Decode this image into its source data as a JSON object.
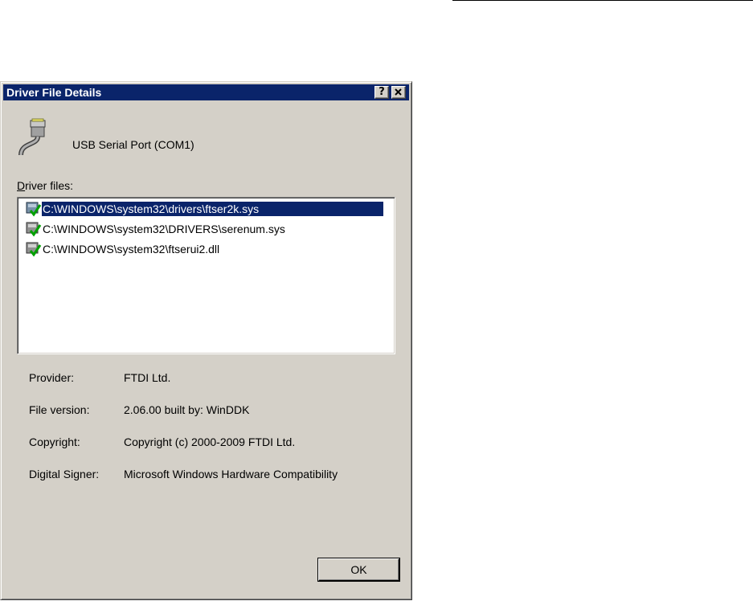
{
  "window": {
    "title": "Driver File Details",
    "help_label": "?",
    "close_label": "✕"
  },
  "device": {
    "name": "USB Serial Port (COM1)",
    "icon": "serial-port-icon"
  },
  "files": {
    "label_accel": "D",
    "label_rest": "river files:",
    "items": [
      {
        "path": "C:\\WINDOWS\\system32\\drivers\\ftser2k.sys",
        "selected": true,
        "icon": "signed-driver-icon"
      },
      {
        "path": "C:\\WINDOWS\\system32\\DRIVERS\\serenum.sys",
        "selected": false,
        "icon": "signed-driver-icon"
      },
      {
        "path": "C:\\WINDOWS\\system32\\ftserui2.dll",
        "selected": false,
        "icon": "signed-driver-icon"
      }
    ]
  },
  "details": {
    "provider_label": "Provider:",
    "provider_value": "FTDI Ltd.",
    "version_label": "File version:",
    "version_value": "2.06.00 built by: WinDDK",
    "copyright_label": "Copyright:",
    "copyright_value": "Copyright (c) 2000-2009 FTDI Ltd.",
    "signer_label": "Digital Signer:",
    "signer_value": "Microsoft Windows Hardware Compatibility"
  },
  "buttons": {
    "ok_label": "OK"
  },
  "colors": {
    "titlebar": "#0a246a",
    "face": "#d4d0c8",
    "selection": "#0a246a"
  }
}
